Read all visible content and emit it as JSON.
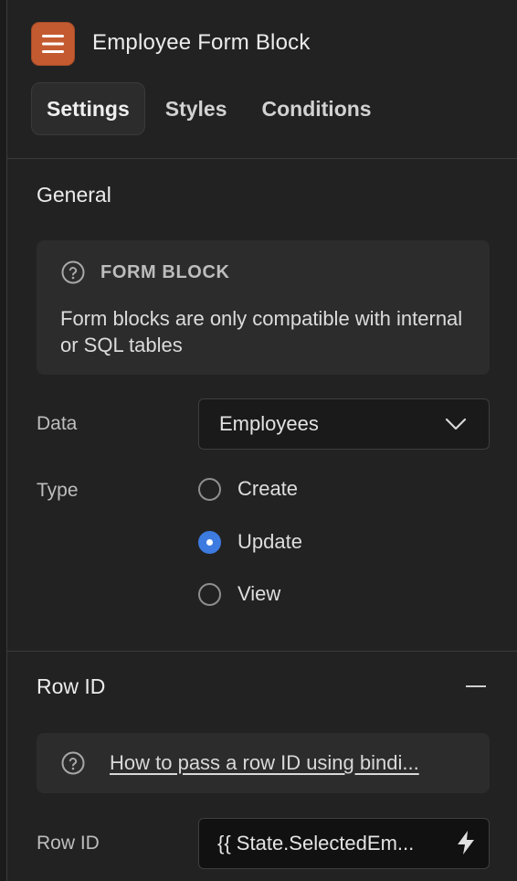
{
  "header": {
    "icon": "hamburger-menu-icon",
    "accent_color": "#c45a30",
    "title": "Employee Form Block",
    "tabs": [
      {
        "label": "Settings",
        "active": true
      },
      {
        "label": "Styles",
        "active": false
      },
      {
        "label": "Conditions",
        "active": false
      }
    ]
  },
  "general": {
    "title": "General",
    "info": {
      "icon": "help-circle-icon",
      "heading": "FORM BLOCK",
      "text": "Form blocks are only compatible with internal or SQL tables"
    },
    "data_field": {
      "label": "Data",
      "value": "Employees"
    },
    "type_field": {
      "label": "Type",
      "options": [
        {
          "label": "Create",
          "selected": false
        },
        {
          "label": "Update",
          "selected": true
        },
        {
          "label": "View",
          "selected": false
        }
      ],
      "selected_color": "#3d7be0"
    }
  },
  "row_id_section": {
    "title": "Row ID",
    "help": {
      "icon": "help-circle-icon",
      "link_text": "How to pass a row ID using bindi..."
    },
    "row_id_field": {
      "label": "Row ID",
      "value": "{{ State.SelectedEm..."
    }
  }
}
